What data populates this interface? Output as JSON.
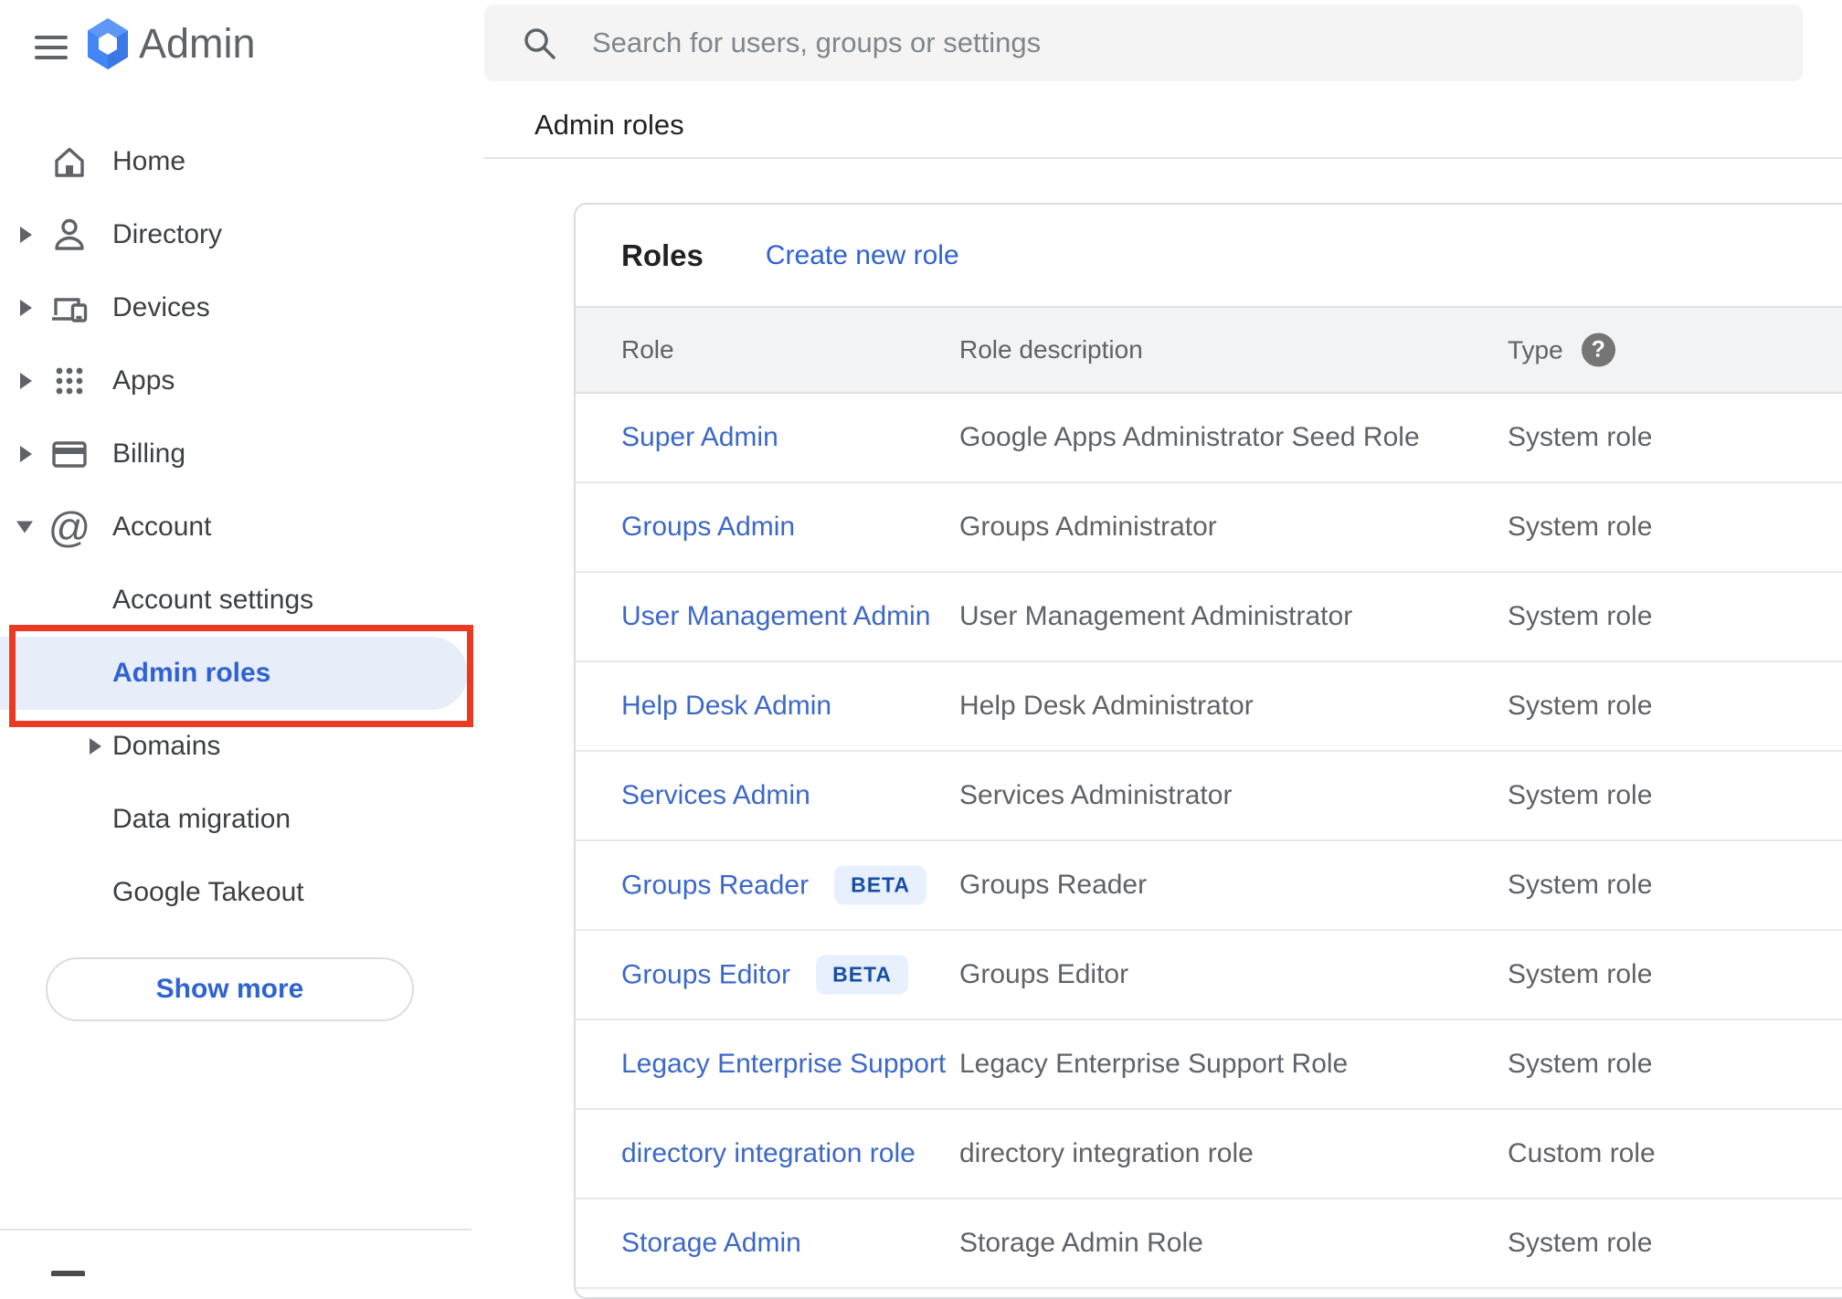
{
  "app": {
    "wordmark": "Admin"
  },
  "search": {
    "placeholder": "Search for users, groups or settings"
  },
  "breadcrumb": "Admin roles",
  "sidebar": {
    "items": [
      {
        "label": "Home",
        "icon": "home-icon",
        "expandable": false
      },
      {
        "label": "Directory",
        "icon": "person-icon",
        "expandable": true,
        "state": "collapsed"
      },
      {
        "label": "Devices",
        "icon": "devices-icon",
        "expandable": true,
        "state": "collapsed"
      },
      {
        "label": "Apps",
        "icon": "apps-grid-icon",
        "expandable": true,
        "state": "collapsed"
      },
      {
        "label": "Billing",
        "icon": "billing-card-icon",
        "expandable": true,
        "state": "collapsed"
      },
      {
        "label": "Account",
        "icon": "at-icon",
        "icon_glyph": "@",
        "expandable": true,
        "state": "expanded"
      }
    ],
    "account_subitems": [
      {
        "label": "Account settings"
      },
      {
        "label": "Admin roles",
        "selected": true,
        "annotated": true
      },
      {
        "label": "Domains",
        "expandable": true,
        "state": "collapsed"
      },
      {
        "label": "Data migration"
      },
      {
        "label": "Google Takeout"
      }
    ],
    "show_more_label": "Show more"
  },
  "main": {
    "card": {
      "title": "Roles",
      "create_link": "Create new role",
      "columns": {
        "role": "Role",
        "description": "Role description",
        "type": "Type"
      },
      "type_help_glyph": "?",
      "rows": [
        {
          "role": "Super Admin",
          "description": "Google Apps Administrator Seed Role",
          "type": "System role"
        },
        {
          "role": "Groups Admin",
          "description": "Groups Administrator",
          "type": "System role"
        },
        {
          "role": "User Management Admin",
          "description": "User Management Administrator",
          "type": "System role"
        },
        {
          "role": "Help Desk Admin",
          "description": "Help Desk Administrator",
          "type": "System role"
        },
        {
          "role": "Services Admin",
          "description": "Services Administrator",
          "type": "System role"
        },
        {
          "role": "Groups Reader",
          "beta_label": "BETA",
          "description": "Groups Reader",
          "type": "System role"
        },
        {
          "role": "Groups Editor",
          "beta_label": "BETA",
          "description": "Groups Editor",
          "type": "System role"
        },
        {
          "role": "Legacy Enterprise Support",
          "description": "Legacy Enterprise Support Role",
          "type": "System role"
        },
        {
          "role": "directory integration role",
          "description": "directory integration role",
          "type": "Custom role"
        },
        {
          "role": "Storage Admin",
          "description": "Storage Admin Role",
          "type": "System role"
        }
      ]
    }
  },
  "colors": {
    "accent_blue": "#2f62d3",
    "link_blue": "#3c68c9",
    "beta_text": "#174ea6",
    "beta_bg": "#e8f0fe",
    "selected_bg": "#e8eef9",
    "annotation_red": "#ea3b22",
    "table_header_bg": "#f1f3f4",
    "search_bg": "#f4f4f4"
  }
}
